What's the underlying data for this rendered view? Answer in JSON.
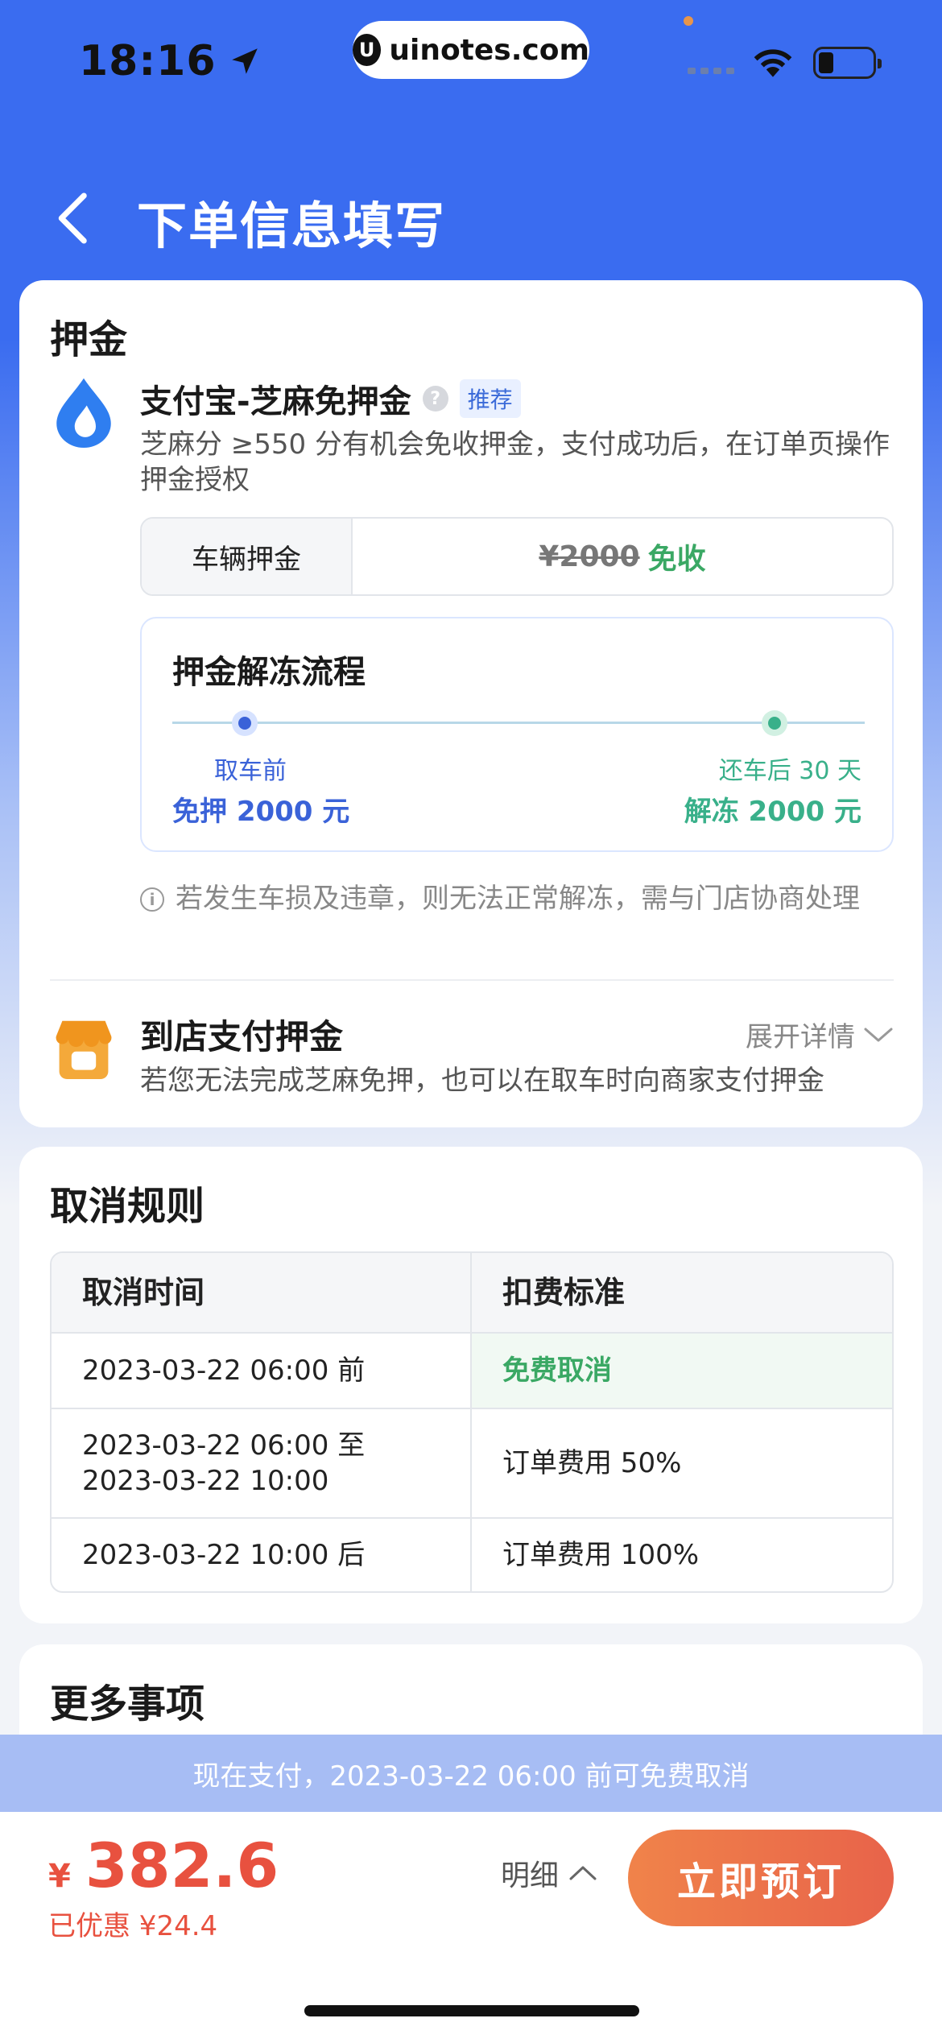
{
  "status_bar": {
    "time": "18:16",
    "url": "uinotes.com",
    "url_logo": "U"
  },
  "header": {
    "title": "下单信息填写"
  },
  "deposit": {
    "section_title": "押金",
    "zhima": {
      "title": "支付宝-芝麻免押金",
      "help": "?",
      "badge": "推荐",
      "desc": "芝麻分 ≥550 分有机会免收押金，支付成功后，在订单页操作押金授权"
    },
    "vehicle": {
      "label": "车辆押金",
      "original": "¥2000",
      "status": "免收"
    },
    "flow": {
      "title": "押金解冻流程",
      "start_label": "取车前",
      "start_value": "免押 2000 元",
      "end_label": "还车后 30 天",
      "end_value": "解冻 2000 元"
    },
    "note_icon": "i",
    "note": "若发生车损及违章，则无法正常解冻，需与门店协商处理",
    "store": {
      "title": "到店支付押金",
      "expand": "展开详情",
      "desc": "若您无法完成芝麻免押，也可以在取车时向商家支付押金"
    }
  },
  "cancel_rules": {
    "section_title": "取消规则",
    "headers": [
      "取消时间",
      "扣费标准"
    ],
    "rows": [
      {
        "time_line1": "2023-03-22 06:00 前",
        "time_line2": "",
        "fee": "免费取消"
      },
      {
        "time_line1": "2023-03-22 06:00 至",
        "time_line2": "2023-03-22 10:00",
        "fee": "订单费用 50%"
      },
      {
        "time_line1": "2023-03-22 10:00 后",
        "time_line2": "",
        "fee": "订单费用 100%"
      }
    ]
  },
  "more": {
    "section_title": "更多事项"
  },
  "notice": "现在支付，2023-03-22 06:00 前可免费取消",
  "bottom": {
    "currency": "¥",
    "amount": "382.6",
    "discount": "已优惠 ¥24.4",
    "detail": "明细",
    "book": "立即预订"
  },
  "colors": {
    "primary": "#3a6cf0",
    "green": "#3aa864",
    "price": "#e8513f",
    "book_button": "#ec6f49"
  },
  "icons": [
    "location-arrow-icon",
    "wifi-icon",
    "battery-icon",
    "back-chevron-icon",
    "alipay-icon",
    "help-icon",
    "info-icon",
    "store-icon",
    "chevron-down-icon",
    "chevron-up-icon"
  ]
}
